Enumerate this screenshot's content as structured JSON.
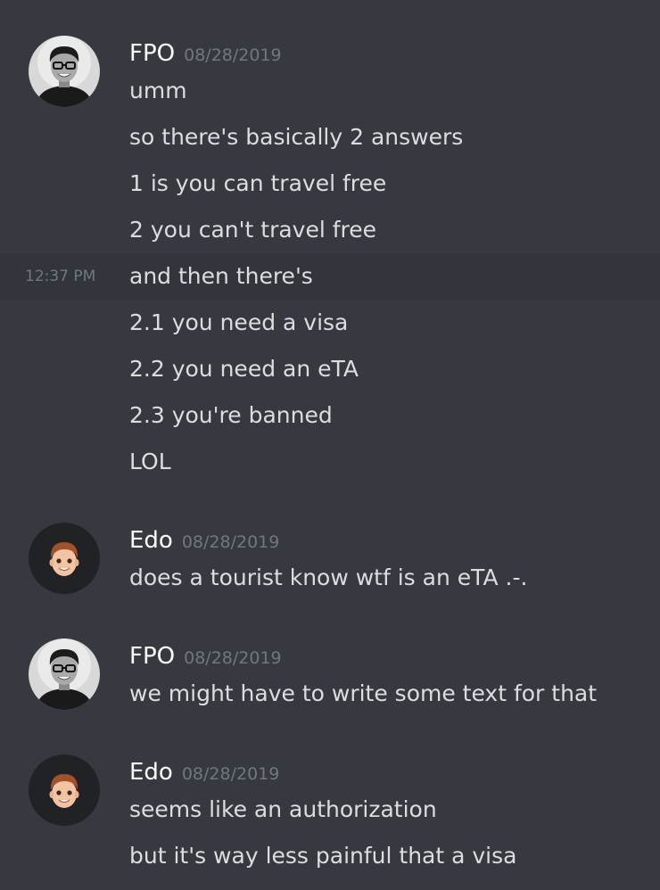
{
  "colors": {
    "background": "#36393f",
    "hover_background": "#32353b",
    "username": "#ffffff",
    "timestamp": "#72767d",
    "message_text": "#dcddde"
  },
  "messages": [
    {
      "author": "FPO",
      "avatar_icon": "person-photo-avatar",
      "timestamp": "08/28/2019",
      "lines": [
        {
          "text": "umm"
        },
        {
          "text": "so there's basically 2 answers"
        },
        {
          "text": "1 is you can travel free"
        },
        {
          "text": "2 you can't travel free"
        },
        {
          "text": "and then there's",
          "hover_time": "12:37 PM"
        },
        {
          "text": "2.1 you need a visa"
        },
        {
          "text": "2.2 you need an eTA"
        },
        {
          "text": "2.3 you're banned"
        },
        {
          "text": "LOL"
        }
      ]
    },
    {
      "author": "Edo",
      "avatar_icon": "memoji-avatar",
      "timestamp": "08/28/2019",
      "lines": [
        {
          "text": "does a tourist know wtf is an eTA .-."
        }
      ]
    },
    {
      "author": "FPO",
      "avatar_icon": "person-photo-avatar",
      "timestamp": "08/28/2019",
      "lines": [
        {
          "text": "we might have to write some text for that"
        }
      ]
    },
    {
      "author": "Edo",
      "avatar_icon": "memoji-avatar",
      "timestamp": "08/28/2019",
      "lines": [
        {
          "text": "seems like an authorization"
        },
        {
          "text": "but it's way less painful that a visa"
        }
      ]
    }
  ]
}
